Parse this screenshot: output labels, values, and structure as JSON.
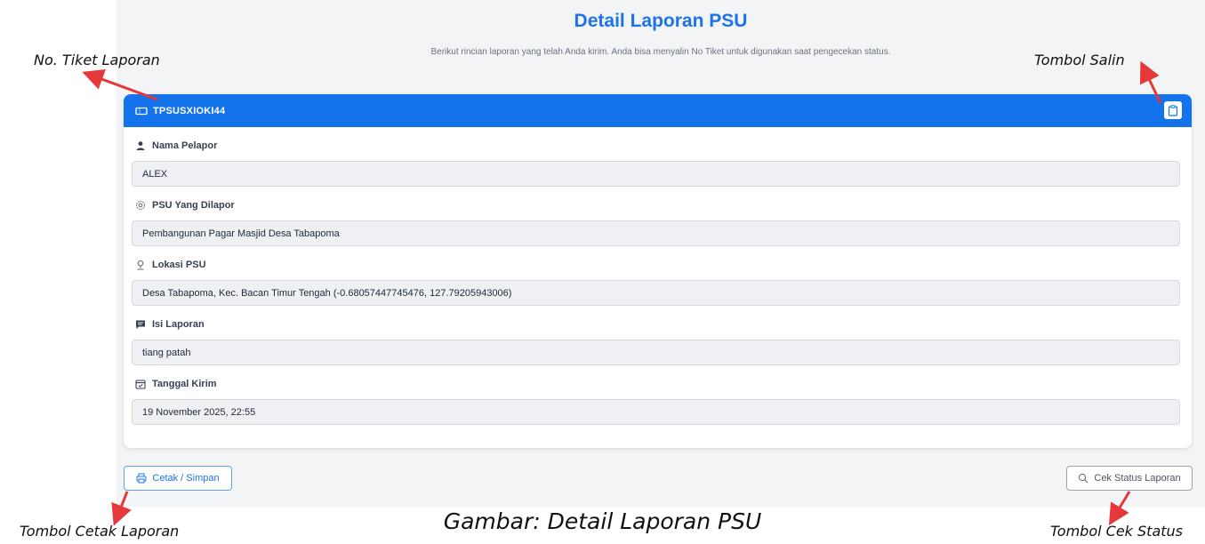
{
  "header": {
    "title": "Detail Laporan PSU",
    "subtitle": "Berikut rincian laporan yang telah Anda kirim. Anda bisa menyalin No Tiket untuk digunakan saat pengecekan status."
  },
  "ticket": {
    "id": "TPSUSXIOKI44",
    "icon": "ticket-icon",
    "copy_icon": "clipboard-icon"
  },
  "fields": [
    {
      "label": "Nama Pelapor",
      "value": "ALEX",
      "icon": "user-icon"
    },
    {
      "label": "PSU Yang Dilapor",
      "value": "Pembangunan Pagar Masjid Desa Tabapoma",
      "icon": "gear-icon"
    },
    {
      "label": "Lokasi PSU",
      "value": "Desa Tabapoma, Kec. Bacan Timur Tengah (-0.68057447745476, 127.79205943006)",
      "icon": "location-pin-icon"
    },
    {
      "label": "Isi Laporan",
      "value": "tiang patah",
      "icon": "message-icon"
    },
    {
      "label": "Tanggal Kirim",
      "value": "19 November 2025, 22:55",
      "icon": "calendar-icon"
    }
  ],
  "actions": {
    "print_label": "Cetak / Simpan",
    "status_label": "Cek Status Laporan"
  },
  "annotations": {
    "ticket_no": "No. Tiket Laporan",
    "copy_button": "Tombol Salin",
    "print_button": "Tombol Cetak Laporan",
    "status_button": "Tombol Cek Status"
  },
  "caption": "Gambar: Detail Laporan PSU",
  "colors": {
    "primary": "#1273eb",
    "title": "#1f73e8",
    "arrow": "#e5383b"
  }
}
